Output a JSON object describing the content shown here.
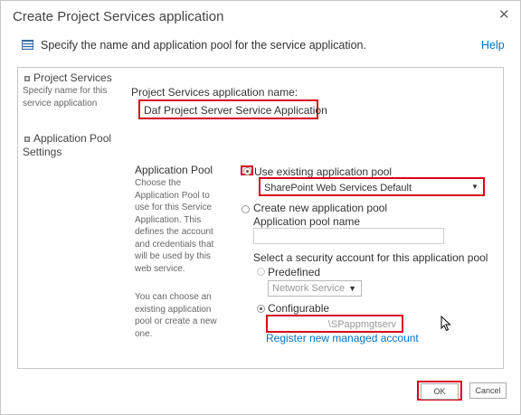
{
  "dialog": {
    "title": "Create Project Services application",
    "close_glyph": "✕",
    "intro": "Specify the name and application pool for the service application.",
    "help": "Help"
  },
  "sections": {
    "project_services": {
      "title": "Project Services",
      "description": "Specify name for this service application",
      "name_label": "Project Services application name:",
      "name_value": "Daf Project Server Service Application"
    },
    "app_pool": {
      "title": "Application Pool Settings",
      "sub_title": "Application Pool",
      "description": "Choose the Application Pool to use for this Service Application.  This defines the account and credentials that will be used by this web service.",
      "description2": "You can choose an existing application pool or create a new one.",
      "use_existing_label": "Use existing application pool",
      "existing_selected": "SharePoint Web Services Default",
      "create_new_label": "Create new application pool",
      "pool_name_label": "Application pool name",
      "pool_name_value": "",
      "security_label": "Select a security account for this application pool",
      "predefined_label": "Predefined",
      "predefined_value": "Network Service",
      "configurable_label": "Configurable",
      "configurable_value": "\\SPappmgtserv",
      "register_link": "Register new managed account"
    }
  },
  "footer": {
    "ok": "OK",
    "cancel": "Cancel"
  },
  "colors": {
    "highlight": "#d9001b",
    "link": "#0072c6"
  }
}
